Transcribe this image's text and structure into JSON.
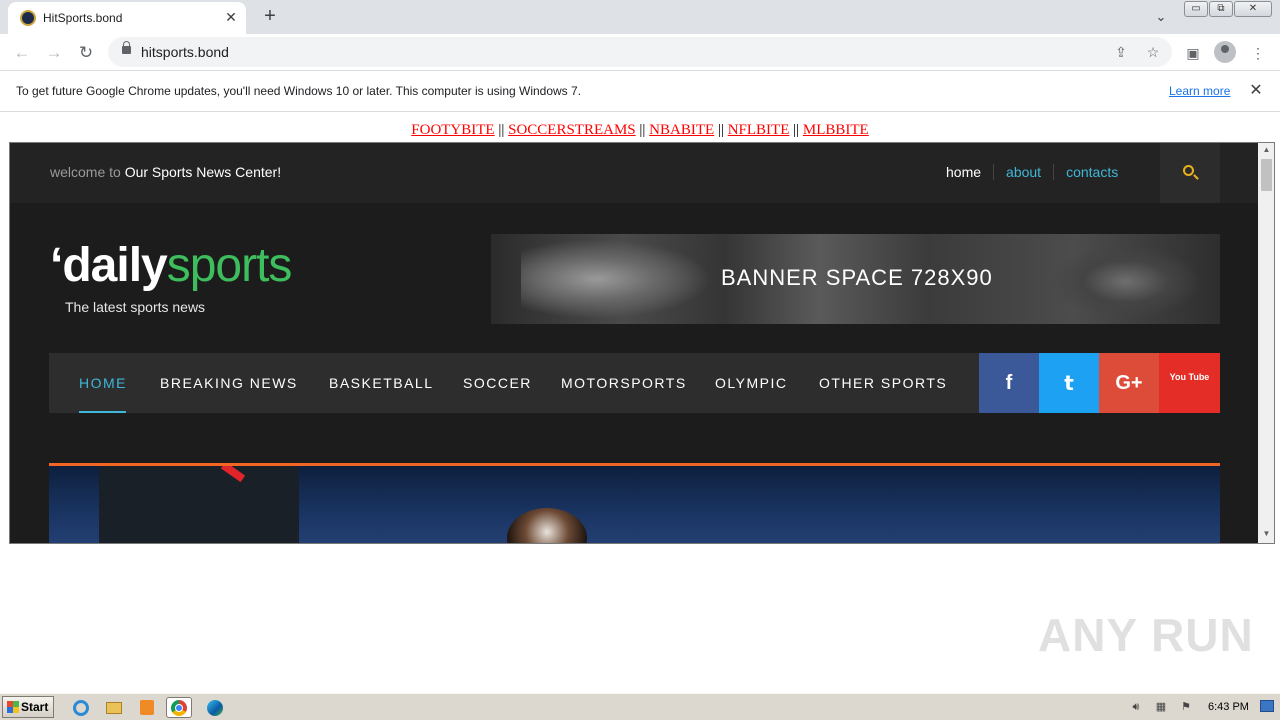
{
  "browser": {
    "tab_title": "HitSports.bond",
    "url": "hitsports.bond",
    "window_buttons": [
      "▭",
      "⧉",
      "✕"
    ]
  },
  "infobar": {
    "message": "To get future Google Chrome updates, you'll need Windows 10 or later. This computer is using Windows 7.",
    "learn_more": "Learn more"
  },
  "page": {
    "top_links": [
      "FOOTYBITE",
      "SOCCERSTREAMS",
      "NBABITE",
      "NFLBITE",
      "MLBBITE"
    ],
    "separator": "||",
    "welcome_prefix": "welcome to",
    "welcome_name": "Our Sports News Center!",
    "header_links": [
      "home",
      "about",
      "contacts"
    ],
    "logo_bold": "‘daily",
    "logo_light": "sports",
    "tagline": "The latest sports news",
    "banner_text": "BANNER SPACE 728X90",
    "main_nav": [
      "HOME",
      "BREAKING NEWS",
      "BASKETBALL",
      "SOCCER",
      "MOTORSPORTS",
      "OLYMPIC",
      "OTHER SPORTS"
    ],
    "social": {
      "facebook": "f",
      "twitter": "t",
      "google": "G+",
      "youtube": "You Tube"
    },
    "colors": {
      "accent_cyan": "#3fb7d8",
      "logo_green": "#3dbd5c",
      "orange": "#f26522",
      "facebook": "#3b5998",
      "twitter": "#1da1f2",
      "google": "#dd4b39",
      "youtube": "#e52d27"
    }
  },
  "watermark": "ANY RUN",
  "taskbar": {
    "start": "Start",
    "time": "6:43 PM"
  }
}
